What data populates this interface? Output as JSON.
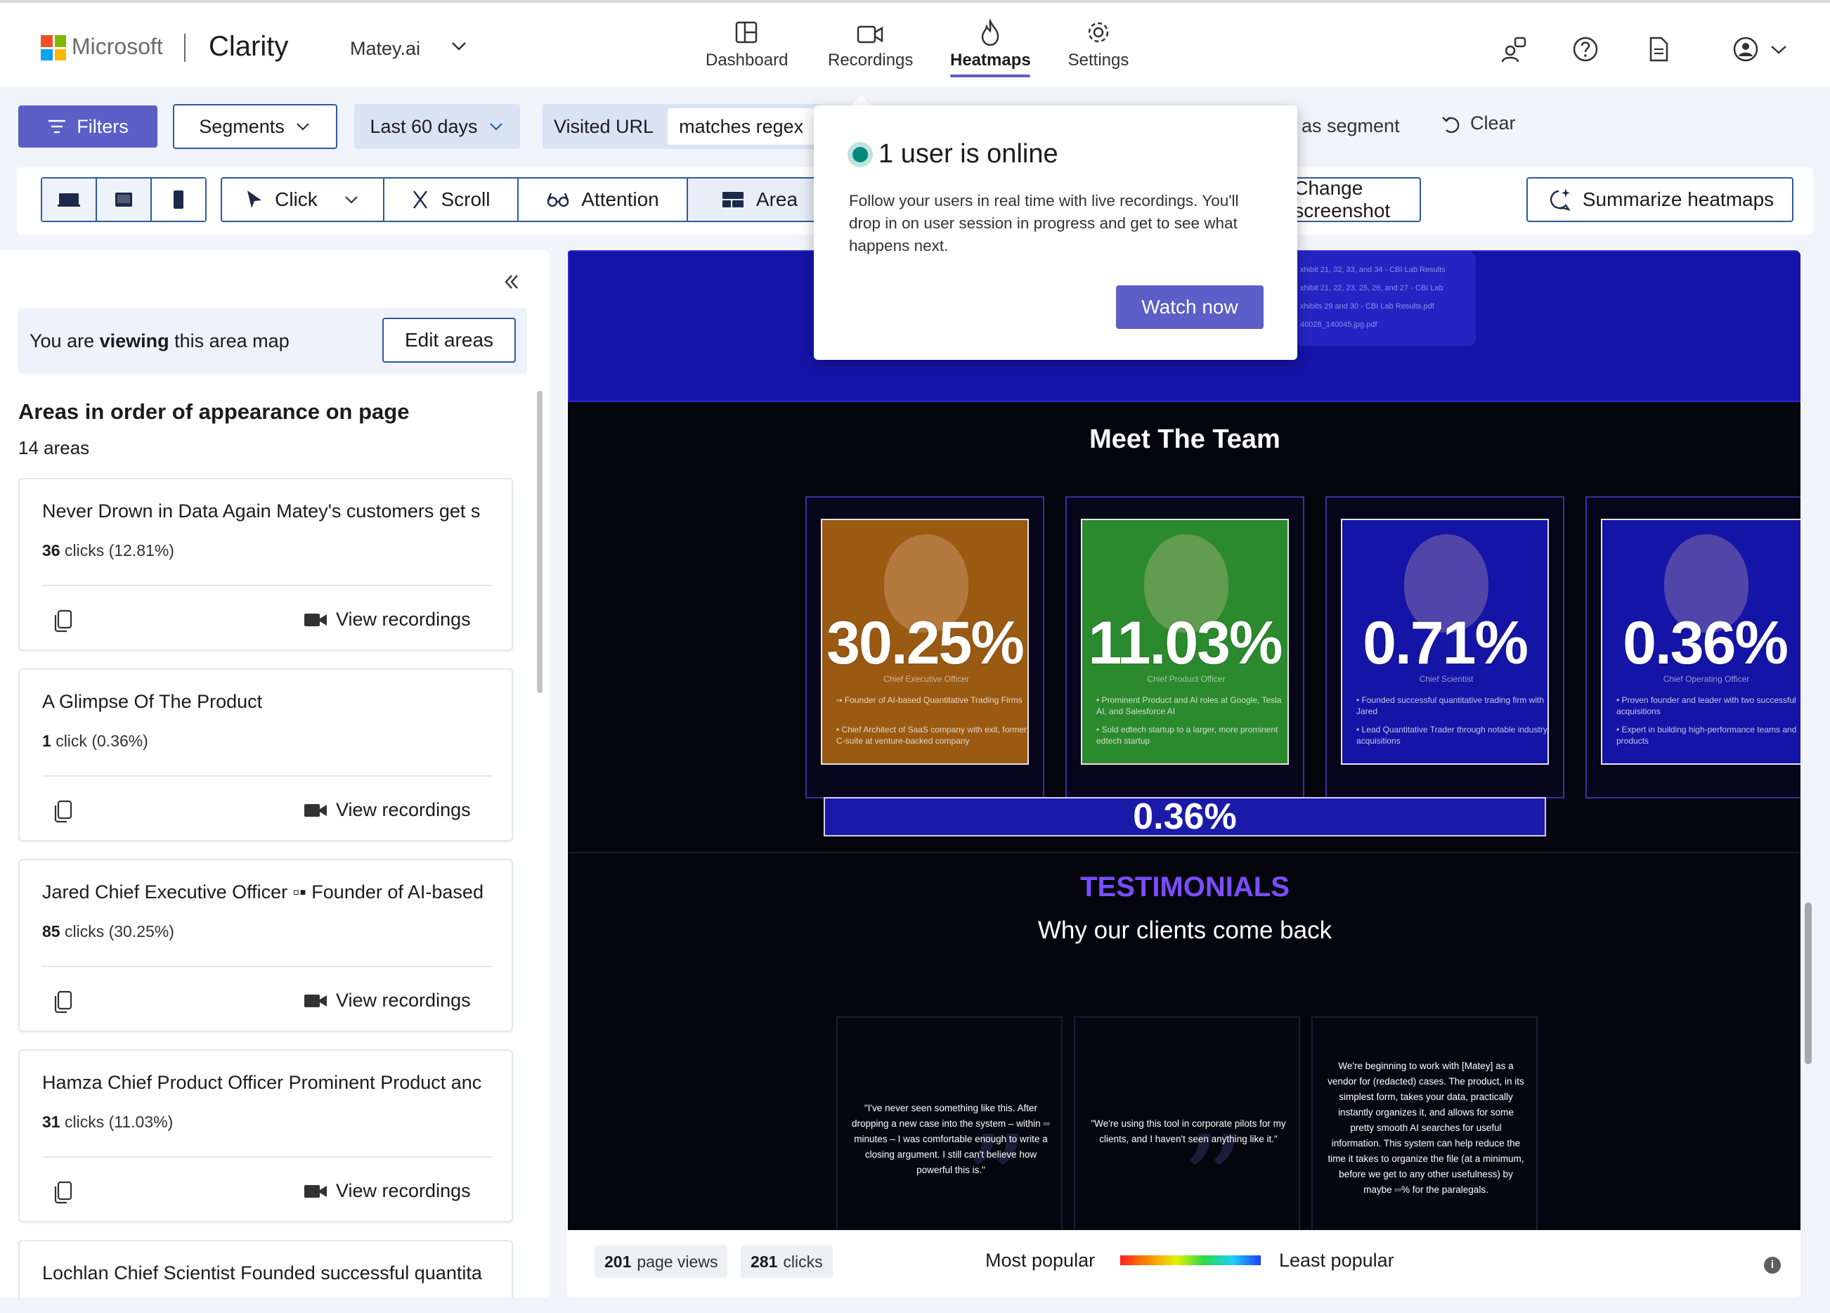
{
  "brand": {
    "company": "Microsoft",
    "app": "Clarity",
    "project": "Matey.ai"
  },
  "nav": [
    {
      "label": "Dashboard",
      "icon": "dashboard-icon"
    },
    {
      "label": "Recordings",
      "icon": "video-icon"
    },
    {
      "label": "Heatmaps",
      "icon": "flame-icon",
      "active": true
    },
    {
      "label": "Settings",
      "icon": "gear-icon"
    }
  ],
  "filters": {
    "filters_label": "Filters",
    "segments_label": "Segments",
    "date_label": "Last 60 days",
    "url_label": "Visited URL",
    "url_value": "matches regex",
    "save_segment": "as segment",
    "clear": "Clear"
  },
  "toolbar": {
    "modes": [
      "Click",
      "Scroll",
      "Attention",
      "Area"
    ],
    "change_screenshot": "Change screenshot",
    "summarize": "Summarize heatmaps"
  },
  "popup": {
    "title": "1 user is online",
    "body": "Follow your users in real time with live recordings. You'll drop in on user session in progress and get to see what happens next.",
    "button": "Watch now"
  },
  "panel": {
    "viewing_prefix": "You are ",
    "viewing_bold": "viewing",
    "viewing_suffix": " this area map",
    "edit_areas": "Edit areas",
    "title": "Areas in order of appearance on page",
    "count": "14 areas",
    "view_recordings": "View recordings",
    "cards": [
      {
        "title": "Never Drown in Data Again Matey's customers get s",
        "num": "36",
        "unit": "clicks",
        "pct": "(12.81%)"
      },
      {
        "title": "A Glimpse Of The Product",
        "num": "1",
        "unit": "click",
        "pct": "(0.36%)"
      },
      {
        "title": "Jared Chief Executive Officer ▫▪ Founder of AI-based",
        "num": "85",
        "unit": "clicks",
        "pct": "(30.25%)"
      },
      {
        "title": "Hamza Chief Product Officer Prominent Product anc",
        "num": "31",
        "unit": "clicks",
        "pct": "(11.03%)"
      },
      {
        "title": "Lochlan Chief Scientist Founded successful quantita",
        "num": "",
        "unit": "",
        "pct": ""
      }
    ]
  },
  "heatmap": {
    "band_docs": [
      "xhibit 21, 32, 33, and 34 - CBI Lab Results",
      "xhibit 21, 22, 23, 25, 26, and 27 - CBI Lab",
      "xhibits 29 and 30 - CBI Lab Results.pdf",
      "40028_140045.jpg.pdf"
    ],
    "team_title": "Meet The Team",
    "members": [
      {
        "pct": "30.25%",
        "color": "#9a5a12",
        "role": "Chief Executive Officer",
        "b1": "▫▪ Founder of AI-based Quantitative Trading Firms",
        "b2": "• Chief Architect of SaaS company with exit, former C-suite at venture-backed company"
      },
      {
        "pct": "11.03%",
        "color": "#2b8a2e",
        "role": "Chief Product Officer",
        "b1": "• Prominent Product and AI roles at Google, Tesla AI, and Salesforce AI",
        "b2": "• Sold edtech startup to a larger, more prominent edtech startup"
      },
      {
        "pct": "0.71%",
        "color": "#1414a6",
        "role": "Chief Scientist",
        "b1": "• Founded successful quantitative trading firm with Jared",
        "b2": "• Lead Quantitative Trader through notable industry acquisitions"
      },
      {
        "pct": "0.36%",
        "color": "#1414a6",
        "role": "Chief Operating Officer",
        "b1": "• Proven founder and leader with two successful acquisitions",
        "b2": "• Expert in building high-performance teams and products"
      }
    ],
    "bar_pct": "0.36%",
    "testimonials_title": "TESTIMONIALS",
    "testimonials_sub": "Why our clients come back",
    "quotes": [
      "\"I've never seen something like this. After dropping a new case into the system – within ▫▫ minutes – I was comfortable enough to write a closing argument. I still can't believe how powerful this is.\"",
      "\"We're using this tool in corporate pilots for my clients, and I haven't seen anything like it.\"",
      "We're beginning to work with [Matey] as a vendor for (redacted) cases. The product, in its simplest form, takes your data, practically instantly organizes it, and allows for some pretty smooth AI searches for useful information. This system can help reduce the time it takes to organize the file (at a minimum, before we get to any other usefulness) by maybe ▫▫% for the paralegals."
    ]
  },
  "footer": {
    "views_num": "201",
    "views_label": "page views",
    "clicks_num": "281",
    "clicks_label": "clicks",
    "most": "Most popular",
    "least": "Least popular"
  }
}
